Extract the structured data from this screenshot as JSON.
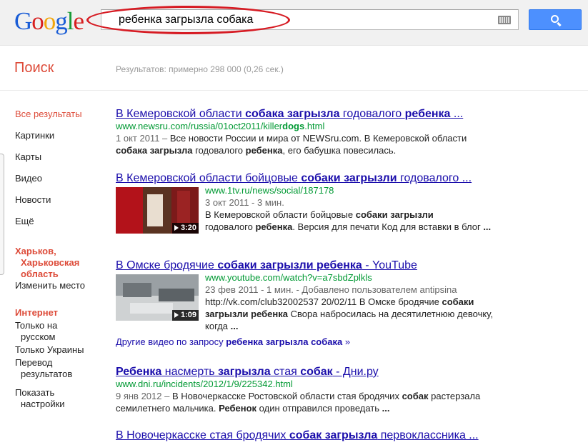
{
  "logo": {
    "letters": [
      "G",
      "o",
      "o",
      "g",
      "l",
      "e"
    ],
    "colors": [
      "#1a5dd6",
      "#d71f1f",
      "#f2a60c",
      "#1a5dd6",
      "#179b37",
      "#d71f1f"
    ]
  },
  "search": {
    "query": "ребенка загрызла собака",
    "button_icon": "search-icon",
    "keyboard_icon": "keyboard-icon"
  },
  "header": {
    "title": "Поиск",
    "stats": "Результатов: примерно 298 000 (0,26 сек.)"
  },
  "sidebar": {
    "items": [
      {
        "label": "Все результаты",
        "active": true
      },
      {
        "label": "Картинки"
      },
      {
        "label": "Карты"
      },
      {
        "label": "Видео"
      },
      {
        "label": "Новости"
      },
      {
        "label": "Ещё"
      }
    ],
    "location_l1": "Харьков,",
    "location_l2": "Харьковская",
    "location_l3": "область",
    "change_location": "Изменить место",
    "section_title": "Интернет",
    "lang_l1": "Только на",
    "lang_l2": "русском",
    "ukraine": "Только Украины",
    "translate_l1": "Перевод",
    "translate_l2": "результатов",
    "settings_l1": "Показать",
    "settings_l2": "настройки"
  },
  "results": [
    {
      "title_parts": [
        "В Кемеровской области ",
        "собака загрызла",
        " годовалого ",
        "ребенка",
        " ..."
      ],
      "url_parts": [
        "www.newsru.com/russia/01oct2011/killer",
        "dogs",
        ".html"
      ],
      "date": "1 окт 2011 – ",
      "snippet_l1": "Все новости России и мира от NEWSru.com. В Кемеровской области",
      "snippet_b1": "собака загрызла",
      "snippet_m": " годовалого ",
      "snippet_b2": "ребенка",
      "snippet_e": ", его бабушка повесилась."
    },
    {
      "title_parts": [
        "В Кемеровской области бойцовые ",
        "собаки загрызли",
        " годовалого ..."
      ],
      "url": "www.1tv.ru/news/social/187178",
      "meta": "3 окт 2011 - 3 мин.",
      "snippet_a": "В Кемеровской области бойцовые ",
      "snippet_b1": "собаки загрызли",
      "snippet_c": "годовалого ",
      "snippet_b2": "ребенка",
      "snippet_d": ". Версия для печати Код для вставки в блог ",
      "snippet_e": "...",
      "duration": "3:20"
    },
    {
      "title_parts": [
        "В Омске бродячие ",
        "собаки загрызли ребенка",
        " - YouTube"
      ],
      "url": "www.youtube.com/watch?v=a7sbdZplkls",
      "meta": "23 фев 2011 - 1 мин. - Добавлено пользователем antipsina",
      "snippet_a": "http://vk.com/club32002537 20/02/11 В Омске бродячие ",
      "snippet_b1": "собаки",
      "snippet_b2": "загрызли ребенка",
      "snippet_c": " Свора набросилась на десятилетнюю девочку, когда ",
      "snippet_e": "...",
      "duration": "1:09"
    },
    {
      "more_prefix": "Другие видео по запросу ",
      "more_bold": "ребенка загрызла собака",
      "more_suffix": " »"
    },
    {
      "title_parts": [
        "Ребенка",
        " насмерть ",
        "загрызла",
        " стая ",
        "собак",
        " - Дни.ру"
      ],
      "url": "www.dni.ru/incidents/2012/1/9/225342.html",
      "date": "9 янв 2012 – ",
      "snippet_a": "В Новочеркасске Ростовской области стая бродячих ",
      "snippet_b1": "собак",
      "snippet_c": " растерзала семилетнего мальчика. ",
      "snippet_b2": "Ребенок",
      "snippet_d": " один отправился проведать ",
      "snippet_e": "..."
    },
    {
      "title_parts": [
        "В Новочеркасске стая бродячих ",
        "собак загрызла",
        " первоклассника ..."
      ]
    }
  ]
}
